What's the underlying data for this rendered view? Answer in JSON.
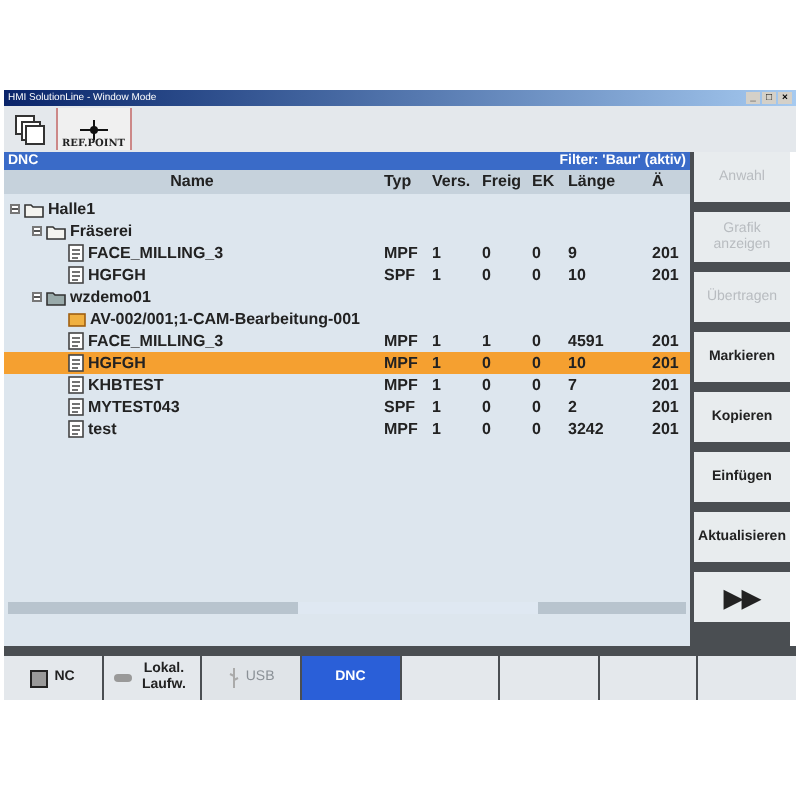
{
  "window": {
    "title": "HMI SolutionLine - Window Mode",
    "controls": [
      "_",
      "□",
      "×"
    ]
  },
  "toolbar": [
    {
      "kind": "windows"
    },
    {
      "kind": "refpoint",
      "label": "REF.POINT"
    }
  ],
  "panel": {
    "title": "DNC",
    "filter": "Filter: 'Baur' (aktiv)"
  },
  "table": {
    "columns": [
      "Name",
      "Typ",
      "Vers.",
      "Freig",
      "EK",
      "Länge",
      "Ä"
    ],
    "rows": [
      {
        "name": "Halle1",
        "kind": "folder",
        "expanded": true,
        "selected": false,
        "children": [
          {
            "name": "Fräserei",
            "kind": "folder",
            "expanded": true,
            "selected": false,
            "children": [
              {
                "name": "FACE_MILLING_3",
                "kind": "file",
                "selected": false,
                "cells": [
                  "MPF",
                  "1",
                  "0",
                  "0",
                  "9",
                  "201"
                ]
              },
              {
                "name": "HGFGH",
                "kind": "file",
                "selected": false,
                "cells": [
                  "SPF",
                  "1",
                  "0",
                  "0",
                  "10",
                  "201"
                ]
              }
            ]
          },
          {
            "name": "wzdemo01",
            "kind": "workpiece",
            "expanded": true,
            "selected": false,
            "children": [
              {
                "name": "AV-002/001;1-CAM-Bearbeitung-001",
                "kind": "job",
                "selected": false
              },
              {
                "name": "FACE_MILLING_3",
                "kind": "file",
                "selected": false,
                "cells": [
                  "MPF",
                  "1",
                  "1",
                  "0",
                  "4591",
                  "201"
                ]
              },
              {
                "name": "HGFGH",
                "kind": "file",
                "selected": true,
                "cells": [
                  "MPF",
                  "1",
                  "0",
                  "0",
                  "10",
                  "201"
                ]
              },
              {
                "name": "KHBTEST",
                "kind": "file",
                "selected": false,
                "cells": [
                  "MPF",
                  "1",
                  "0",
                  "0",
                  "7",
                  "201"
                ]
              },
              {
                "name": "MYTEST043",
                "kind": "file",
                "selected": false,
                "cells": [
                  "SPF",
                  "1",
                  "0",
                  "0",
                  "2",
                  "201"
                ]
              },
              {
                "name": "test",
                "kind": "file",
                "selected": false,
                "cells": [
                  "MPF",
                  "1",
                  "0",
                  "0",
                  "3242",
                  "201"
                ]
              }
            ]
          }
        ]
      }
    ]
  },
  "softkeys": [
    {
      "label": "Anwahl",
      "disabled": true
    },
    {
      "label": "Grafik anzeigen",
      "disabled": true
    },
    {
      "label": "Übertragen",
      "disabled": true
    },
    {
      "label": "Markieren",
      "disabled": false
    },
    {
      "label": "Kopieren",
      "disabled": false
    },
    {
      "label": "Einfügen",
      "disabled": false
    },
    {
      "label": "Aktualisieren",
      "disabled": false
    },
    {
      "label": "▶▶",
      "disabled": false
    }
  ],
  "tabs": [
    {
      "label": "NC",
      "selected": false,
      "disabled": false
    },
    {
      "label": "Lokal. Laufw.",
      "selected": false,
      "disabled": false
    },
    {
      "label": "USB",
      "selected": false,
      "disabled": true
    },
    {
      "label": "DNC",
      "selected": true,
      "disabled": false
    },
    {
      "selected": false
    },
    {
      "selected": false
    },
    {
      "selected": false
    },
    {
      "selected": false
    }
  ]
}
